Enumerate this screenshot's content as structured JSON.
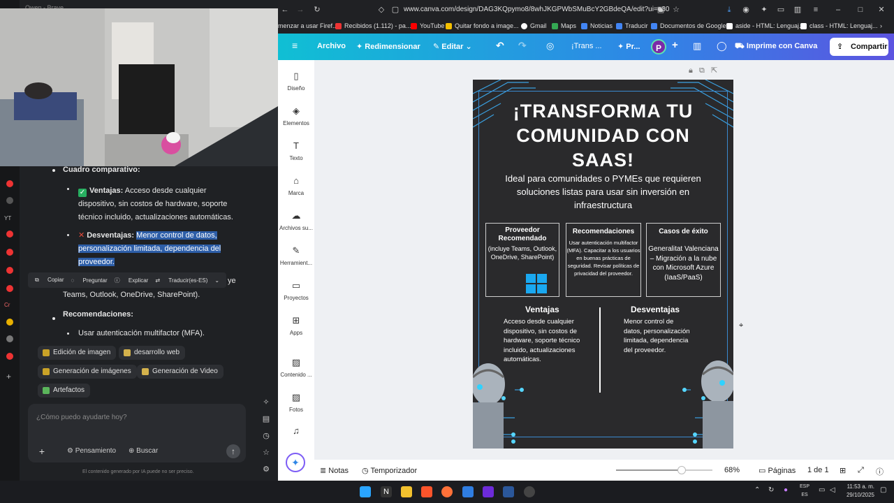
{
  "left_window": {
    "title": "Qwen - Brave",
    "rail_labels": [
      "YT",
      "Cr"
    ]
  },
  "chat": {
    "heading": "Cuadro comparativo:",
    "ventajas_label": "Ventajas:",
    "ventajas_text": "Acceso desde cualquier dispositivo, sin costos de hardware, soporte técnico incluido, actualizaciones automáticas.",
    "desventajas_label": "Desventajas:",
    "desventajas_text": "Menor control de datos, personalización limitada, dependencia del proveedor.",
    "partial_line_tail": "ye",
    "partial_line": "Teams, Outlook, OneDrive, SharePoint).",
    "recomendaciones_label": "Recomendaciones:",
    "recomendacion_item": "Usar autenticación multifactor (MFA).",
    "context_menu": [
      "Copiar",
      "Preguntar",
      "Explicar",
      "Traducir(es-ES)"
    ],
    "chips": [
      "Edición de imagen",
      "desarrollo web",
      "Generación de imágenes",
      "Generación de Video",
      "Artefactos"
    ],
    "prompt_placeholder": "¿Cómo puedo ayudarte hoy?",
    "btn_pensamiento": "Pensamiento",
    "btn_buscar": "Buscar",
    "disclaimer": "El contenido generado por IA puede no ser preciso."
  },
  "browser": {
    "url": "www.canva.com/design/DAG3KQpymo8/8whJKGPWbSMuBcY2GBdeQA/edit?ui=e30",
    "bookmarks": [
      "menzar a usar Firef...",
      "Recibidos (1.112) - pa...",
      "YouTube",
      "Quitar fondo a image...",
      "Gmail",
      "Maps",
      "Noticias",
      "Traducir",
      "Documentos de Google",
      "aside - HTML: Lenguaj...",
      "class - HTML: Lenguaj..."
    ]
  },
  "canva_toolbar": {
    "archivo": "Archivo",
    "redimensionar": "Redimensionar",
    "editar": "Editar",
    "title_short": "¡Trans ...",
    "pr": "Pr...",
    "avatar": "P",
    "print": "Imprime con Canva",
    "share": "Compartir"
  },
  "canva_sidebar": [
    "Diseño",
    "Elementos",
    "Texto",
    "Marca",
    "Archivos su...",
    "Herramient...",
    "Proyectos",
    "Apps",
    "Contenido ...",
    "Fotos"
  ],
  "design": {
    "title_lines": [
      "¡TRANSFORMA TU",
      "COMUNIDAD CON",
      "SAAS!"
    ],
    "subtitle": "Ideal para comunidades o PYMEs que requieren soluciones listas para usar sin inversión en infraestructura",
    "card1_title": "Proveedor Recomendado",
    "card1_body": "(incluye Teams, Outlook, OneDrive, SharePoint)",
    "card2_title": "Recomendaciones",
    "card2_body": "Usar autenticación multifactor (MFA). Capacitar a los usuarios en buenas prácticas de seguridad. Revisar políticas de privacidad del proveedor.",
    "card3_title": "Casos de éxito",
    "card3_body": "Generalitat Valenciana – Migración a la nube con Microsoft Azure (IaaS/PaaS)",
    "ventajas_title": "Ventajas",
    "ventajas_body": "Acceso desde cualquier dispositivo, sin costos de hardware, soporte técnico incluido, actualizaciones automáticas.",
    "desventajas_title": "Desventajas",
    "desventajas_body": "Menor control de datos, personalización limitada, dependencia del proveedor."
  },
  "bottom_bar": {
    "notas": "Notas",
    "temporizador": "Temporizador",
    "zoom": "68%",
    "zoom_fraction": 0.68,
    "paginas": "Páginas",
    "page_count": "1 de 1"
  },
  "taskbar": {
    "time": "11:53 a. m.",
    "date": "29/10/2025",
    "lang": "ESP",
    "lang2": "ES"
  },
  "colors": {
    "accent_start": "#10bfd4",
    "accent_end": "#5c54e0",
    "highlight": "#2d5ea8",
    "design_bg": "#2a2a2c",
    "frame": "#3a8ad0"
  }
}
